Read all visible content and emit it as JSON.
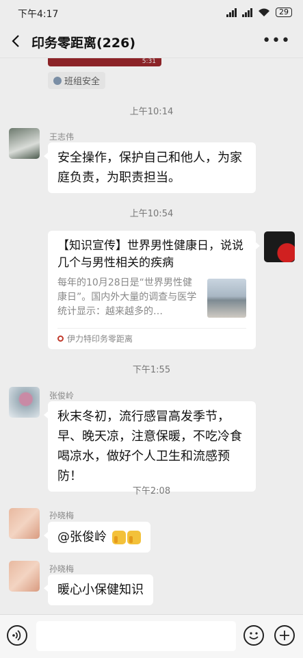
{
  "status_bar": {
    "time": "下午4:17",
    "battery": "29"
  },
  "header": {
    "title": "印务零距离(226)"
  },
  "partial_card": {
    "tag": "5:31",
    "source": "班组安全"
  },
  "messages": [
    {
      "timestamp": "上午10:14",
      "sender": "王志伟",
      "text": "安全操作，保护自己和他人，为家庭负责，为职责担当。"
    },
    {
      "timestamp": "上午10:54",
      "article_title": "【知识宣传】世界男性健康日，说说几个与男性相关的疾病",
      "article_desc": "每年的10月28日是“世界男性健康日”。国内外大量的调查与医学统计显示：越来越多的…",
      "article_source": "伊力特印务零距离"
    },
    {
      "timestamp": "下午1:55",
      "sender": "张俊岭",
      "text": "秋末冬初，流行感冒高发季节，早、晚天凉，注意保暖，不吃冷食喝凉水，做好个人卫生和流感预防！"
    },
    {
      "timestamp": "下午2:08",
      "sender": "孙晓梅",
      "text": "@张俊岭"
    },
    {
      "sender": "孙晓梅",
      "text": "暖心小保健知识"
    }
  ],
  "input": {
    "placeholder": ""
  }
}
